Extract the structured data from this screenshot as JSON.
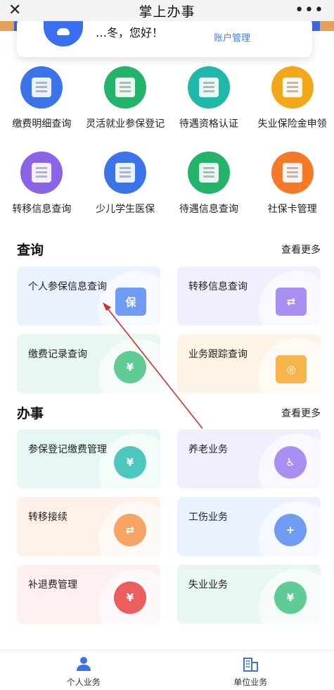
{
  "header": {
    "title": "掌上办事",
    "close_icon": "✕",
    "more_icon": "•••"
  },
  "account": {
    "greeting": "…冬，您好！",
    "manage_link": "账户管理"
  },
  "quick_services": [
    {
      "label": "缴费明细查询",
      "color": "#3b74e8",
      "icon": "document-search-icon"
    },
    {
      "label": "灵活就业参保登记",
      "color": "#23b36b",
      "icon": "form-edit-icon"
    },
    {
      "label": "待遇资格认证",
      "color": "#20b8a8",
      "icon": "id-card-icon"
    },
    {
      "label": "失业保险金申领",
      "color": "#f2a81a",
      "icon": "document-upload-icon"
    },
    {
      "label": "转移信息查询",
      "color": "#8a63e6",
      "icon": "transfer-document-icon"
    },
    {
      "label": "少儿学生医保",
      "color": "#3b74e8",
      "icon": "person-card-icon"
    },
    {
      "label": "待遇信息查询",
      "color": "#23b36b",
      "icon": "person-search-icon"
    },
    {
      "label": "社保卡管理",
      "color": "#f47a2a",
      "icon": "bank-card-icon"
    }
  ],
  "query_section": {
    "title": "查询",
    "more": "查看更多",
    "cards": [
      {
        "label": "个人参保信息查询",
        "bg": "#eaf2ff",
        "icon_color": "#6f9cf2",
        "icon_text": "保"
      },
      {
        "label": "转移信息查询",
        "bg": "#f1eefe",
        "icon_color": "#a790f2",
        "icon_text": "⇄"
      },
      {
        "label": "缴费记录查询",
        "bg": "#e8f7ef",
        "icon_color": "#5fcc96",
        "icon_text": "¥"
      },
      {
        "label": "业务跟踪查询",
        "bg": "#fef4e6",
        "icon_color": "#f5b54a",
        "icon_text": "◎"
      }
    ]
  },
  "work_section": {
    "title": "办事",
    "more": "查看更多",
    "cards": [
      {
        "label": "参保登记缴费管理",
        "bg": "#e6f7f5",
        "icon_color": "#4cc7bd",
        "icon_text": "¥"
      },
      {
        "label": "养老业务",
        "bg": "#f1eefe",
        "icon_color": "#a790f2",
        "icon_text": "♿"
      },
      {
        "label": "转移接续",
        "bg": "#fff1e8",
        "icon_color": "#f6a364",
        "icon_text": "⇄"
      },
      {
        "label": "工伤业务",
        "bg": "#eaf2ff",
        "icon_color": "#6f9cf2",
        "icon_text": "+"
      },
      {
        "label": "补退费管理",
        "bg": "#ffefef",
        "icon_color": "#ec5e5e",
        "icon_text": "¥"
      },
      {
        "label": "失业业务",
        "bg": "#e8f7ef",
        "icon_color": "#5fcc96",
        "icon_text": "¥"
      }
    ]
  },
  "bottom_nav": {
    "personal": "个人业务",
    "unit": "单位业务"
  },
  "colors": {
    "accent": "#3b74e8",
    "arrow": "#d92c25"
  }
}
